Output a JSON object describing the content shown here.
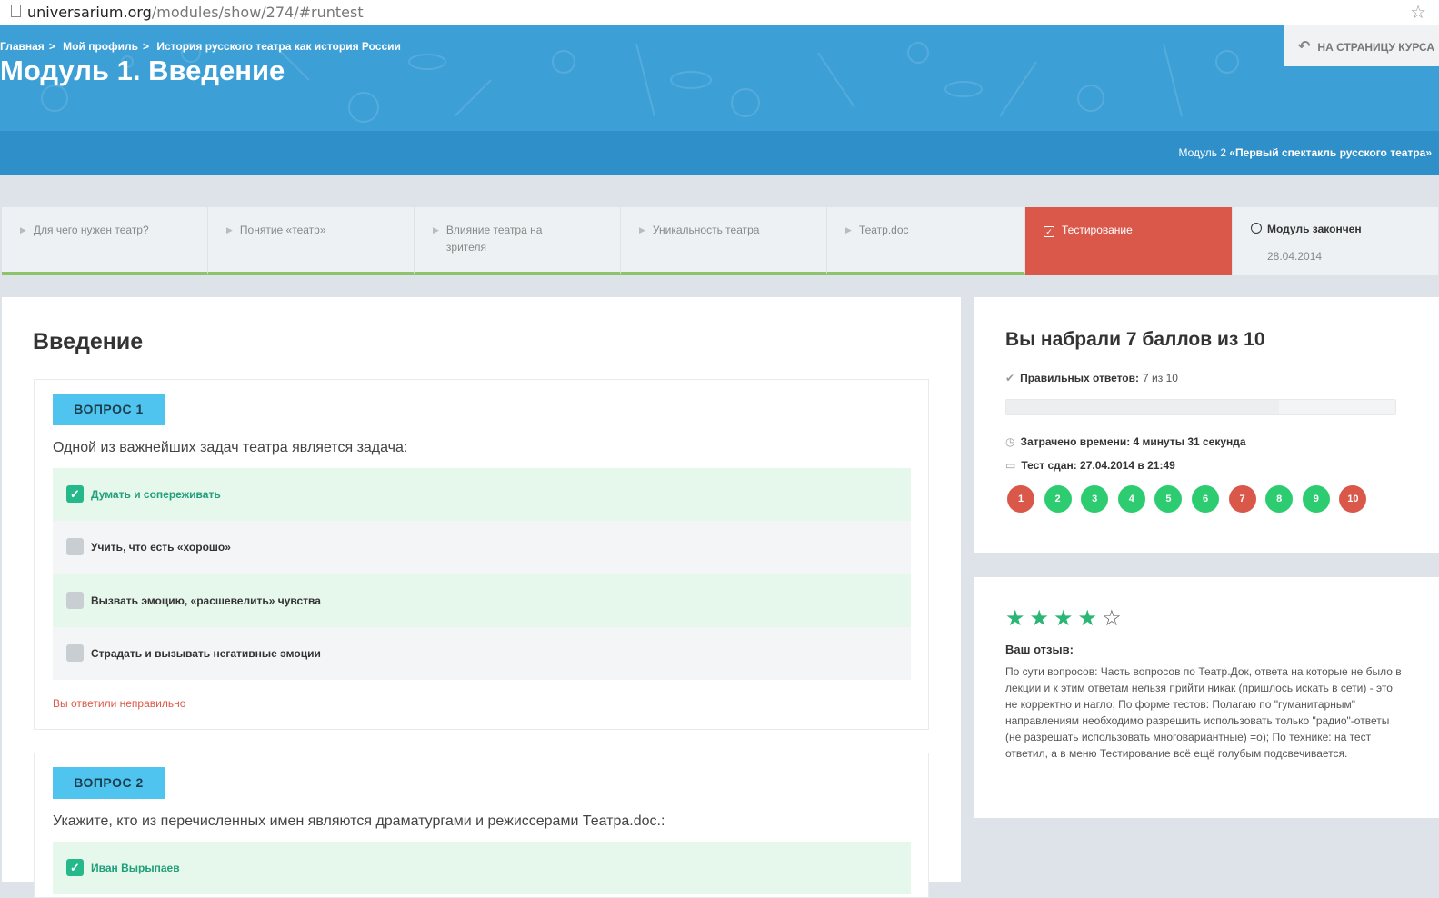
{
  "browser": {
    "url_host": "universarium.org",
    "url_path": "/modules/show/274/#runtest"
  },
  "header": {
    "breadcrumb": [
      "Главная",
      "Мой профиль",
      "История русского театра как история России"
    ],
    "title": "Модуль 1. Введение",
    "course_button": "НА СТРАНИЦУ КУРСА",
    "next_module_prefix": "Модуль 2",
    "next_module_name": "«Первый спектакль русского театра»"
  },
  "steps": [
    {
      "label": "Для чего нужен театр?"
    },
    {
      "label": "Понятие «театр»"
    },
    {
      "label": "Влияние театра на зрителя"
    },
    {
      "label": "Уникальность театра"
    },
    {
      "label": "Театр.doc"
    },
    {
      "label": "Тестирование"
    },
    {
      "label": "Модуль закончен",
      "date": "28.04.2014"
    }
  ],
  "main": {
    "title": "Введение",
    "questions": [
      {
        "tag": "ВОПРОС 1",
        "text": "Одной из важнейших задач театра является задача:",
        "answers": [
          "Думать и сопереживать",
          "Учить, что есть «хорошо»",
          "Вызвать эмоцию, «расшевелить» чувства",
          "Страдать и вызывать негативные эмоции"
        ],
        "verdict": "Вы ответили неправильно"
      },
      {
        "tag": "ВОПРОС 2",
        "text": "Укажите, кто из перечисленных имен являются драматургами и режиссерами Театра.doc.:",
        "answers": [
          "Иван Вырыпаев"
        ]
      }
    ]
  },
  "score": {
    "title": "Вы набрали 7 баллов из 10",
    "correct_label": "Правильных ответов:",
    "correct_value": "7 из 10",
    "progress": 0.7,
    "time_label": "Затрачено времени: 4 минуты 31 секунда",
    "date_label": "Тест сдан: 27.04.2014 в 21:49",
    "results": [
      {
        "n": "1",
        "ok": false
      },
      {
        "n": "2",
        "ok": true
      },
      {
        "n": "3",
        "ok": true
      },
      {
        "n": "4",
        "ok": true
      },
      {
        "n": "5",
        "ok": true
      },
      {
        "n": "6",
        "ok": true
      },
      {
        "n": "7",
        "ok": false
      },
      {
        "n": "8",
        "ok": true
      },
      {
        "n": "9",
        "ok": true
      },
      {
        "n": "10",
        "ok": false
      }
    ],
    "colors": {
      "correct": "#2ecc71",
      "wrong": "#d9584a"
    }
  },
  "review": {
    "rating": 4,
    "rating_max": 5,
    "label": "Ваш отзыв:",
    "text": "По сути вопросов: Часть вопросов по Театр.Док, ответа на которые не было в лекции и к этим ответам нельзя прийти никак (пришлось искать в сети) - это не корректно и нагло; По форме тестов: Полагаю по \"гуманитарным\" направлениям необходимо разрешить использовать только \"радио\"-ответы (не разрешать использовать многовариантные) =о); По технике: на тест ответил, а в меню Тестирование всё ещё голубым подсвечивается."
  }
}
